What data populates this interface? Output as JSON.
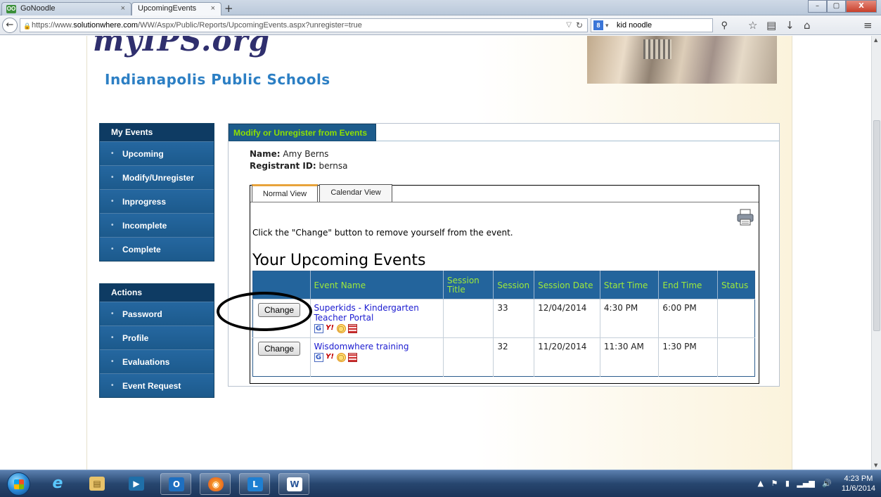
{
  "browser": {
    "tabs": [
      {
        "title": "GoNoodle",
        "favicon": "OO"
      },
      {
        "title": "UpcomingEvents"
      }
    ],
    "tab_close_glyph": "×",
    "new_tab_glyph": "+",
    "url_prefix": "https://www.",
    "url_host": "solutionwhere.com",
    "url_path": "/WW/Aspx/Public/Reports/UpcomingEvents.aspx?unregister=true",
    "search_engine_badge": "8",
    "search_text": "kid noodle",
    "window_controls": {
      "minimize": "–",
      "maximize": "▢",
      "close": "X"
    }
  },
  "header": {
    "logo_text": "myIPS.org",
    "logo_subtitle": "Indianapolis Public Schools"
  },
  "sidebar": {
    "my_events_title": "My Events",
    "my_events": [
      {
        "label": "Upcoming"
      },
      {
        "label": "Modify/Unregister"
      },
      {
        "label": "Inprogress"
      },
      {
        "label": "Incomplete"
      },
      {
        "label": "Complete"
      }
    ],
    "actions_title": "Actions",
    "actions": [
      {
        "label": "Password"
      },
      {
        "label": "Profile"
      },
      {
        "label": "Evaluations"
      },
      {
        "label": "Event Request"
      }
    ]
  },
  "content": {
    "tab_title": "Modify or Unregister from Events",
    "name_label": "Name:",
    "name_value": "Amy Berns",
    "registrant_label": "Registrant ID:",
    "registrant_value": "bernsa",
    "view_tabs": [
      {
        "label": "Normal View",
        "active": true
      },
      {
        "label": "Calendar View",
        "active": false
      }
    ],
    "instructions": "Click the \"Change\" button to remove yourself from the event.",
    "section_title": "Your Upcoming Events",
    "table": {
      "columns": [
        "",
        "Event Name",
        "Session Title",
        "Session",
        "Session Date",
        "Start Time",
        "End Time",
        "Status"
      ],
      "rows": [
        {
          "button": "Change",
          "event_name": "Superkids - Kindergarten Teacher Portal",
          "session_title": "",
          "session": "33",
          "session_date": "12/04/2014",
          "start_time": "4:30 PM",
          "end_time": "6:00 PM",
          "status": ""
        },
        {
          "button": "Change",
          "event_name": "Wisdomwhere training",
          "session_title": "",
          "session": "32",
          "session_date": "11/20/2014",
          "start_time": "11:30 AM",
          "end_time": "1:30 PM",
          "status": ""
        }
      ]
    },
    "calendar_icon_letters": {
      "google": "G",
      "yahoo": "Y!"
    }
  },
  "taskbar": {
    "apps": [
      {
        "name": "ie",
        "glyph": "e"
      },
      {
        "name": "explorer",
        "glyph": "▤"
      },
      {
        "name": "media",
        "glyph": "▶"
      },
      {
        "name": "outlook",
        "glyph": "O"
      },
      {
        "name": "firefox",
        "glyph": "◉"
      },
      {
        "name": "lync",
        "glyph": "L"
      },
      {
        "name": "word",
        "glyph": "W"
      }
    ],
    "clock_time": "4:23 PM",
    "clock_date": "11/6/2014"
  },
  "colors": {
    "sidebar_blue": "#1d5c8c",
    "sidebar_title": "#0e3b63",
    "table_header_bg": "#23649c",
    "table_header_text": "#9eea3a",
    "link": "#1a1ad0",
    "logo_blue": "#2c7fc4"
  }
}
